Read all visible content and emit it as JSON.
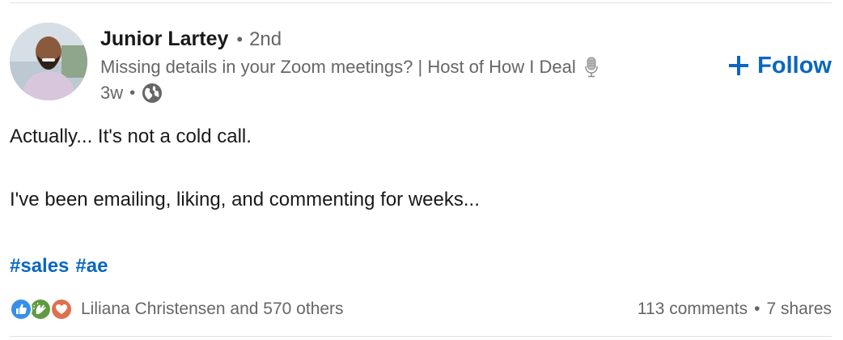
{
  "post": {
    "author": {
      "name": "Junior Lartey",
      "separator": "•",
      "degree": "2nd",
      "headline": "Missing details in your Zoom meetings? | Host of How I Deal",
      "age": "3w",
      "age_separator": "•"
    },
    "follow_label": "Follow",
    "body_lines": [
      "Actually... It's not a cold call.",
      "I've been emailing, liking, and commenting for weeks..."
    ],
    "hashtags": [
      "#sales",
      "#ae"
    ],
    "social": {
      "reactors": "Liliana Christensen and 570 others",
      "comments": "113 comments",
      "separator": "•",
      "shares": "7 shares"
    }
  },
  "colors": {
    "accent": "#0a66c2",
    "text_primary": "#191919",
    "text_secondary": "#666666",
    "reaction_like": "#378fe9",
    "reaction_celebrate": "#5f9b41",
    "reaction_love": "#df704d"
  },
  "icons": {
    "headline_badge": "microphone-icon",
    "visibility": "globe-icon",
    "follow": "plus-icon",
    "reactions": [
      "like-icon",
      "celebrate-icon",
      "love-icon"
    ]
  }
}
